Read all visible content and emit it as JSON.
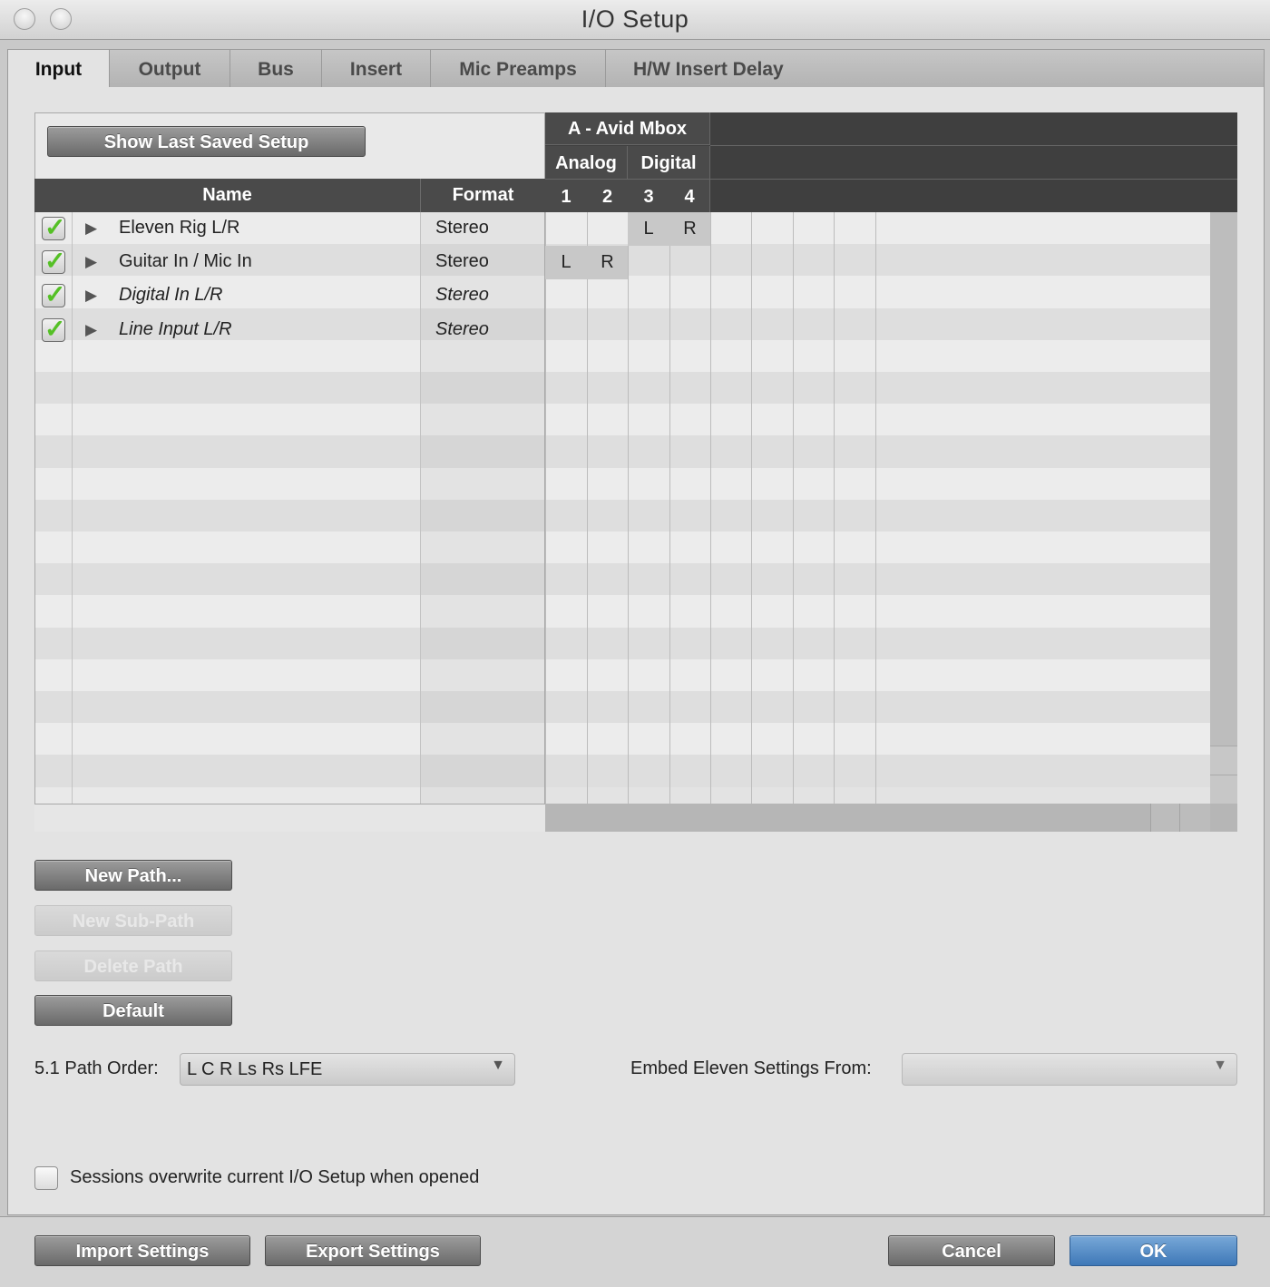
{
  "window": {
    "title": "I/O Setup"
  },
  "tabs": [
    {
      "label": "Input",
      "active": true
    },
    {
      "label": "Output"
    },
    {
      "label": "Bus"
    },
    {
      "label": "Insert"
    },
    {
      "label": "Mic Preamps"
    },
    {
      "label": "H/W Insert Delay"
    }
  ],
  "table": {
    "show_last_saved_label": "Show Last Saved Setup",
    "col_name": "Name",
    "col_format": "Format",
    "device": "A - Avid Mbox",
    "group_analog": "Analog",
    "group_digital": "Digital",
    "channels": [
      "1",
      "2",
      "3",
      "4"
    ],
    "rows": [
      {
        "name": "Eleven Rig L/R",
        "format": "Stereo",
        "checked": true,
        "italic": false,
        "assign": [
          "",
          "",
          "L",
          "R"
        ]
      },
      {
        "name": "Guitar In / Mic In",
        "format": "Stereo",
        "checked": true,
        "italic": false,
        "assign": [
          "L",
          "R",
          "",
          ""
        ]
      },
      {
        "name": "Digital In L/R",
        "format": "Stereo",
        "checked": true,
        "italic": true,
        "assign": [
          "",
          "",
          "",
          ""
        ]
      },
      {
        "name": "Line Input L/R",
        "format": "Stereo",
        "checked": true,
        "italic": true,
        "assign": [
          "",
          "",
          "",
          ""
        ]
      }
    ]
  },
  "buttons": {
    "new_path": "New Path...",
    "new_sub_path": "New Sub-Path",
    "delete_path": "Delete Path",
    "default": "Default",
    "import": "Import Settings",
    "export": "Export Settings",
    "cancel": "Cancel",
    "ok": "OK"
  },
  "path_order": {
    "label": "5.1 Path Order:",
    "value": "L C R Ls Rs LFE"
  },
  "embed": {
    "label": "Embed Eleven Settings From:",
    "value": ""
  },
  "overwrite": {
    "label": "Sessions overwrite current I/O Setup when opened",
    "checked": false
  },
  "colors": {
    "check_green": "#55c026",
    "ok_blue": "#3e78b8",
    "header_dark": "#4a4a4a",
    "assigned_cell": "#c8c8c8"
  },
  "icons": {
    "check": "check-icon",
    "expand": "expand-triangle-icon",
    "dropdown": "chevron-down-icon"
  }
}
